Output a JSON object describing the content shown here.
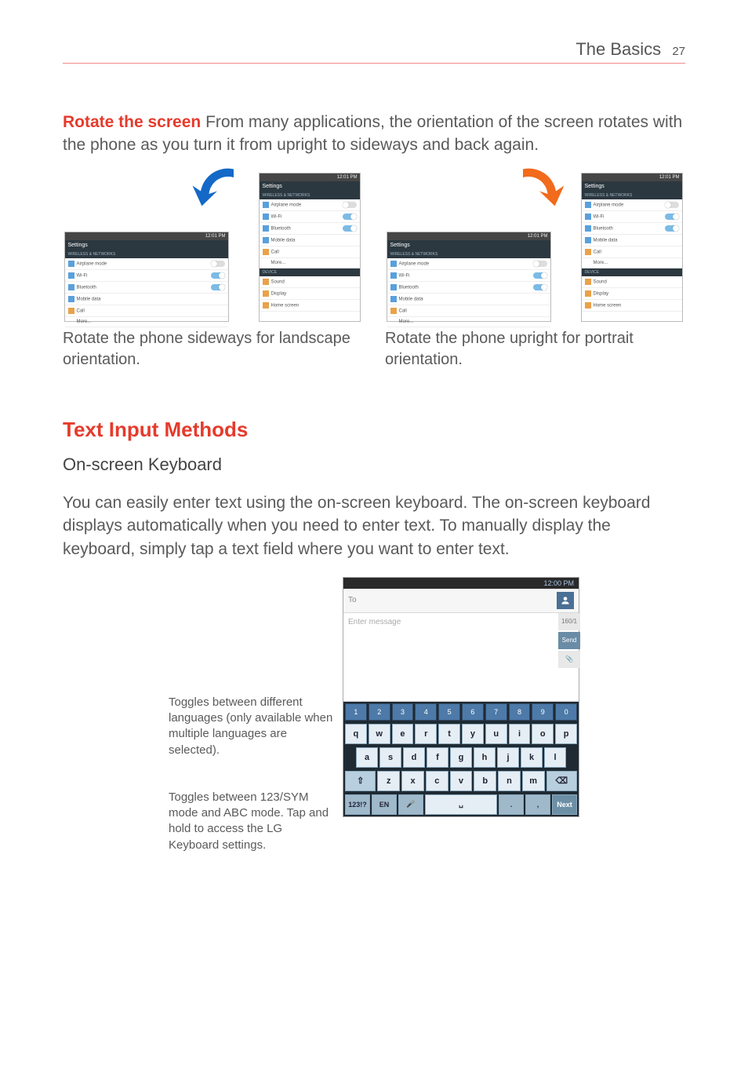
{
  "header": {
    "section": "The Basics",
    "page": "27"
  },
  "rotate": {
    "title": "Rotate the screen",
    "body": " From many applications, the orientation of the screen rotates with the phone as you turn it from upright to sideways and back again.",
    "caption_left": "Rotate the phone sideways for landscape orientation.",
    "caption_right": "Rotate the phone upright for portrait orientation."
  },
  "settings_menu": {
    "title": "Settings",
    "section": "WIRELESS & NETWORKS",
    "items": [
      {
        "label": "Airplane mode",
        "toggle": false
      },
      {
        "label": "Wi-Fi",
        "toggle": true
      },
      {
        "label": "Bluetooth",
        "toggle": true
      },
      {
        "label": "Mobile data",
        "toggle": null
      },
      {
        "label": "Call",
        "toggle": null
      },
      {
        "label": "More...",
        "toggle": null
      }
    ],
    "device_section": "DEVICE",
    "device_items": [
      "Sound",
      "Display",
      "Home screen"
    ],
    "status_time_port": "12:01 PM",
    "status_time_land": "12:01 PM"
  },
  "text_input": {
    "heading": "Text Input Methods",
    "sub": "On-screen Keyboard",
    "body": "You can easily enter text using the on-screen keyboard. The on-screen keyboard displays automatically when you need to enter text. To manually display the keyboard, simply tap a text field where you want to enter text.",
    "annot_lang": "Toggles between different languages (only available when multiple languages are selected).",
    "annot_mode": "Toggles between 123/SYM mode and ABC mode. Tap and hold to access the LG Keyboard settings."
  },
  "keyboard": {
    "status_time": "12:00 PM",
    "to_placeholder": "To",
    "msg_placeholder": "Enter message",
    "side": [
      "160/1",
      "Send",
      "📎"
    ],
    "num_row": [
      "1",
      "2",
      "3",
      "4",
      "5",
      "6",
      "7",
      "8",
      "9",
      "0"
    ],
    "row2": [
      "q",
      "w",
      "e",
      "r",
      "t",
      "y",
      "u",
      "i",
      "o",
      "p"
    ],
    "row3": [
      "a",
      "s",
      "d",
      "f",
      "g",
      "h",
      "j",
      "k",
      "l"
    ],
    "row4_shift": "⇧",
    "row4": [
      "z",
      "x",
      "c",
      "v",
      "b",
      "n",
      "m"
    ],
    "row4_del": "⌫",
    "row5": {
      "sym": "123!?",
      "lang": "EN",
      "mic": "🎤",
      "space": "␣",
      "dot": ".",
      "comma": ",",
      "next": "Next"
    }
  }
}
